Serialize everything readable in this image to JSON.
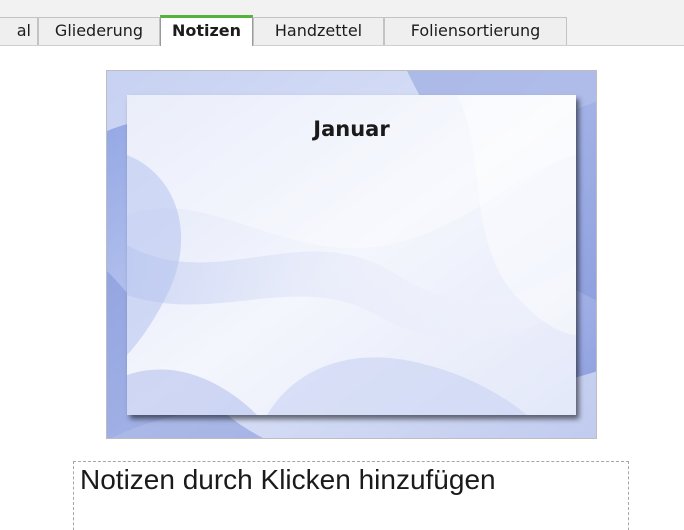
{
  "tabs": {
    "partial_label": "al",
    "gliederung": "Gliederung",
    "notizen": "Notizen",
    "handzettel": "Handzettel",
    "foliensortierung": "Foliensortierung",
    "active": "Notizen",
    "active_color": "#52b43b"
  },
  "slide": {
    "title": "Januar",
    "background_color": "#aab8ea"
  },
  "notes": {
    "placeholder": "Notizen durch Klicken hinzufügen"
  }
}
